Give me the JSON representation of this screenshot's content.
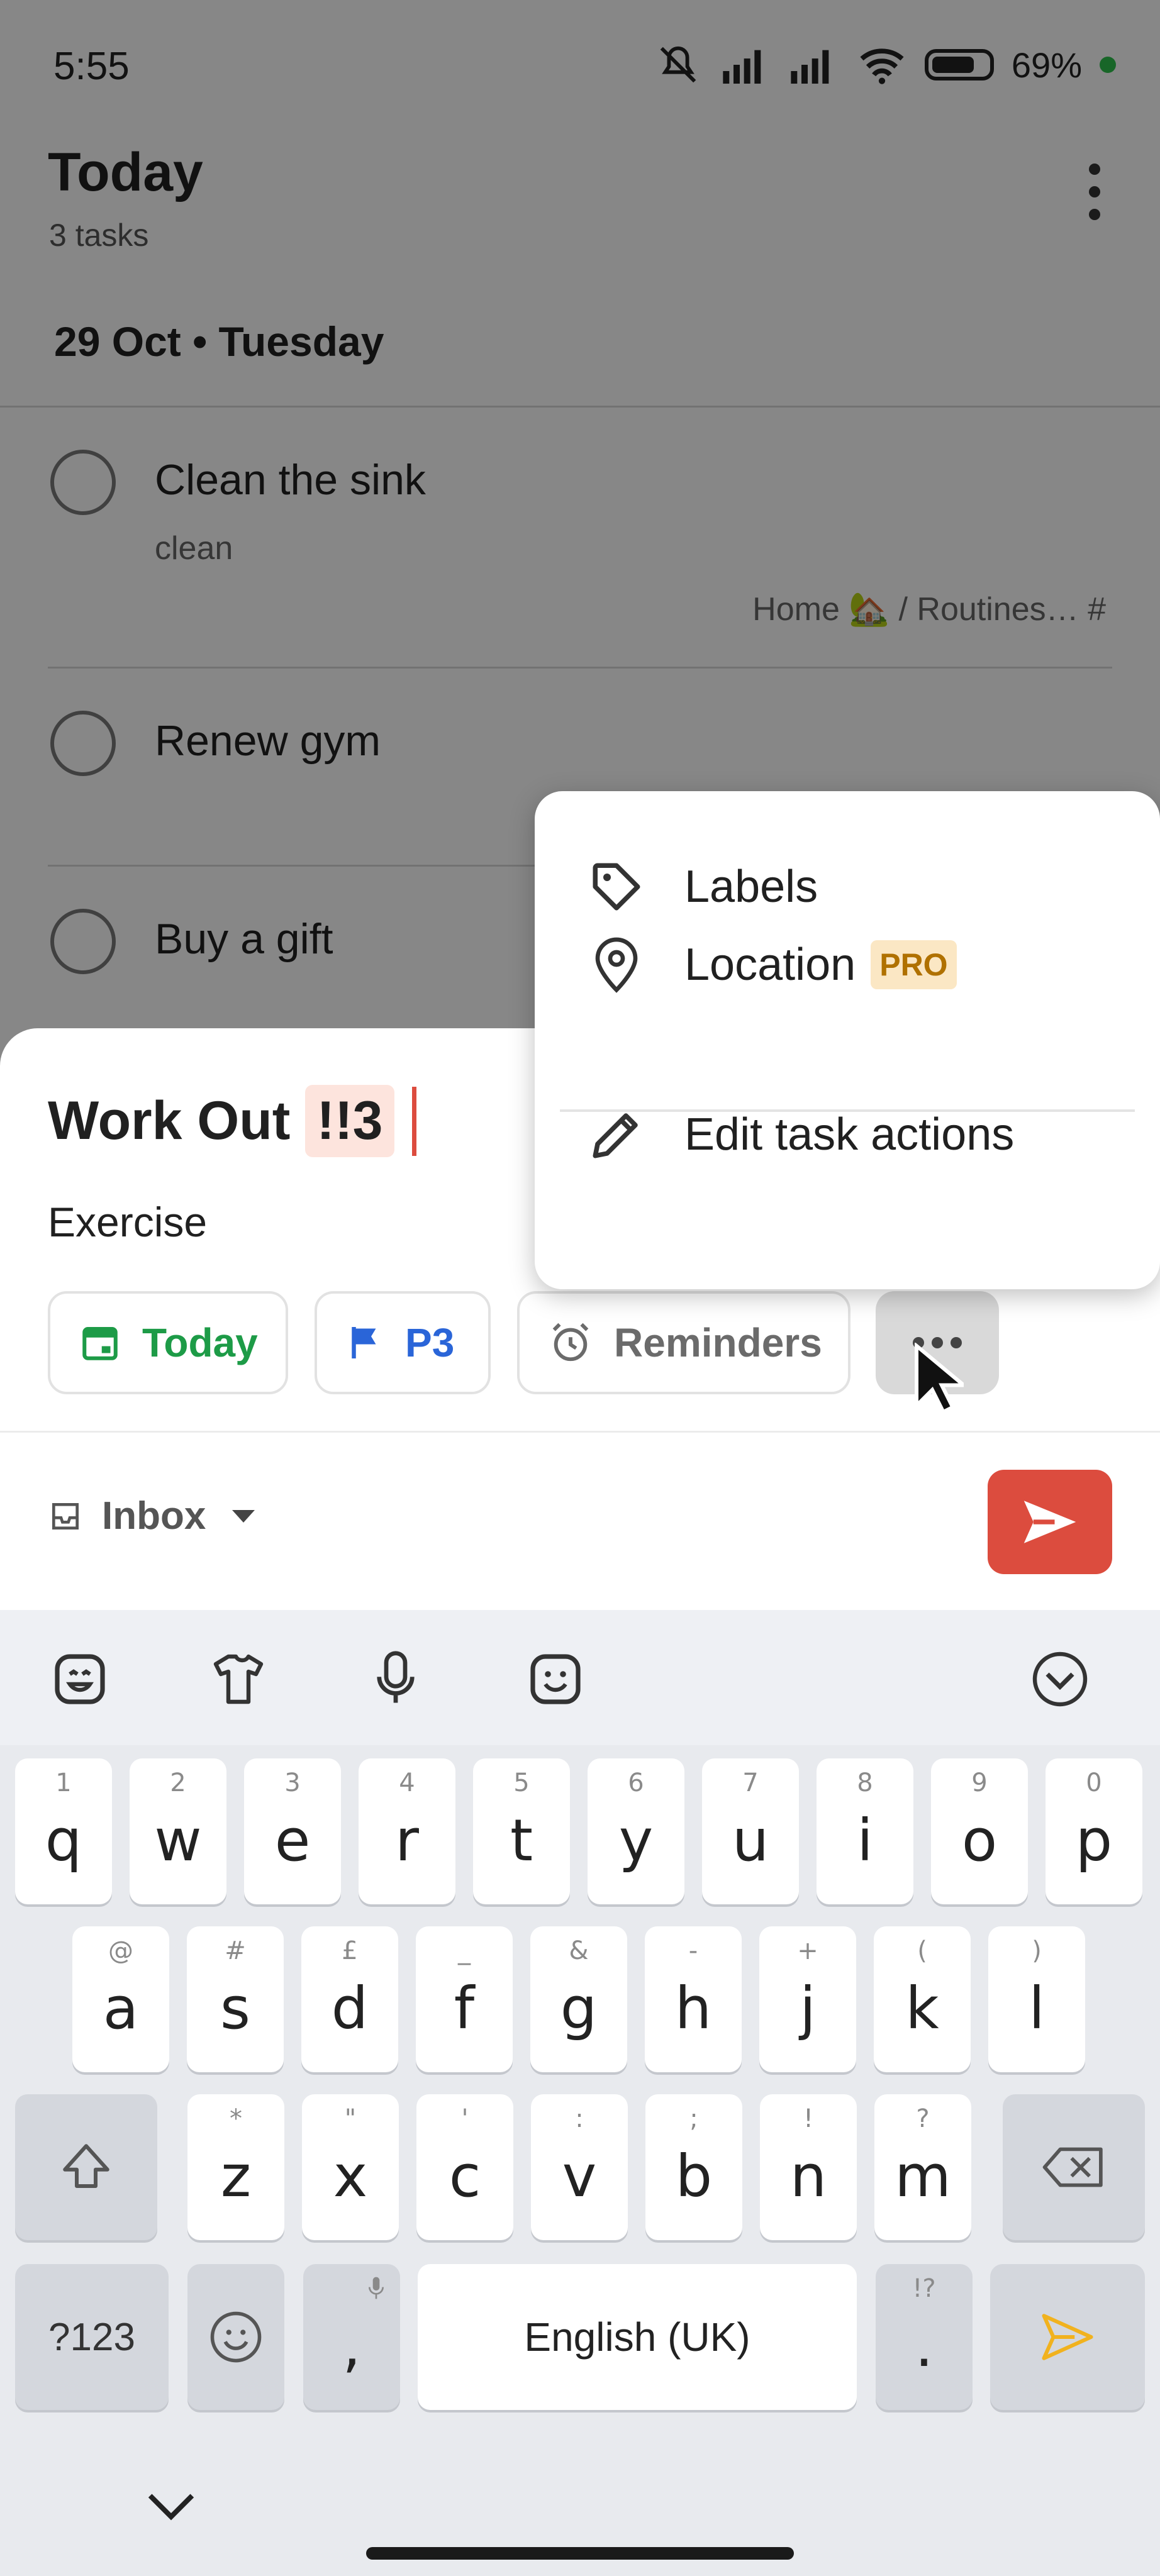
{
  "status_bar": {
    "time": "5:55",
    "battery": "69"
  },
  "header": {
    "title": "Today",
    "subtitle": "3 tasks"
  },
  "date_header": "29 Oct • Tuesday",
  "tasks": [
    {
      "title": "Clean the sink",
      "description": "clean",
      "project": "Home 🏡 / Routines… #"
    },
    {
      "title": "Renew gym",
      "description": "",
      "project": ""
    },
    {
      "title": "Buy a gift",
      "description": "",
      "project": ""
    }
  ],
  "quick_add": {
    "task_name": "Work Out",
    "priority_token": "!!3",
    "description": "Exercise",
    "chips": {
      "date": "Today",
      "priority": "P3",
      "reminders": "Reminders"
    },
    "project": "Inbox",
    "colors": {
      "date": "#1d9b47",
      "priority": "#2a65d8",
      "send": "#dc4c3e"
    }
  },
  "menu": {
    "items": [
      {
        "label": "Labels",
        "icon": "tag-icon"
      },
      {
        "label": "Location",
        "icon": "location-pin-icon",
        "badge": "PRO"
      },
      {
        "label": "Edit task actions",
        "icon": "pencil-icon"
      }
    ]
  },
  "keyboard": {
    "row1": [
      {
        "key": "q",
        "hint": "1"
      },
      {
        "key": "w",
        "hint": "2"
      },
      {
        "key": "e",
        "hint": "3"
      },
      {
        "key": "r",
        "hint": "4"
      },
      {
        "key": "t",
        "hint": "5"
      },
      {
        "key": "y",
        "hint": "6"
      },
      {
        "key": "u",
        "hint": "7"
      },
      {
        "key": "i",
        "hint": "8"
      },
      {
        "key": "o",
        "hint": "9"
      },
      {
        "key": "p",
        "hint": "0"
      }
    ],
    "row2": [
      {
        "key": "a",
        "hint": "@"
      },
      {
        "key": "s",
        "hint": "#"
      },
      {
        "key": "d",
        "hint": "£"
      },
      {
        "key": "f",
        "hint": "_"
      },
      {
        "key": "g",
        "hint": "&"
      },
      {
        "key": "h",
        "hint": "-"
      },
      {
        "key": "j",
        "hint": "+"
      },
      {
        "key": "k",
        "hint": "("
      },
      {
        "key": "l",
        "hint": ")"
      }
    ],
    "row3": [
      {
        "key": "z",
        "hint": "*"
      },
      {
        "key": "x",
        "hint": "\""
      },
      {
        "key": "c",
        "hint": "'"
      },
      {
        "key": "v",
        "hint": ":"
      },
      {
        "key": "b",
        "hint": ";"
      },
      {
        "key": "n",
        "hint": "!"
      },
      {
        "key": "m",
        "hint": "?"
      }
    ],
    "symbols_key": "?123",
    "comma": ",",
    "space_label": "English (UK)",
    "period": ".",
    "period_hint": "!?"
  }
}
